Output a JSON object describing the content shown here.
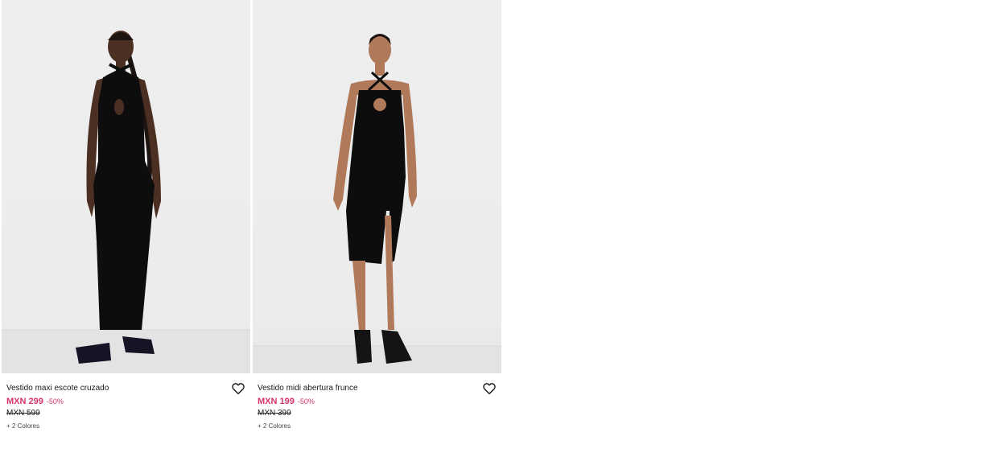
{
  "products": [
    {
      "title": "Vestido maxi escote cruzado",
      "price": "MXN 299",
      "discount": "-50%",
      "old_price": "MXN 599",
      "colors": "+ 2 Colores",
      "image_icon": "product-photo-maxi-dress"
    },
    {
      "title": "Vestido midi abertura frunce",
      "price": "MXN 199",
      "discount": "-50%",
      "old_price": "MXN 399",
      "colors": "+ 2 Colores",
      "image_icon": "product-photo-midi-dress"
    }
  ],
  "colors": {
    "sale_price": "#d6336c",
    "text": "#1a1a1a",
    "background": "#ffffff",
    "photo_background": "#ececec"
  }
}
